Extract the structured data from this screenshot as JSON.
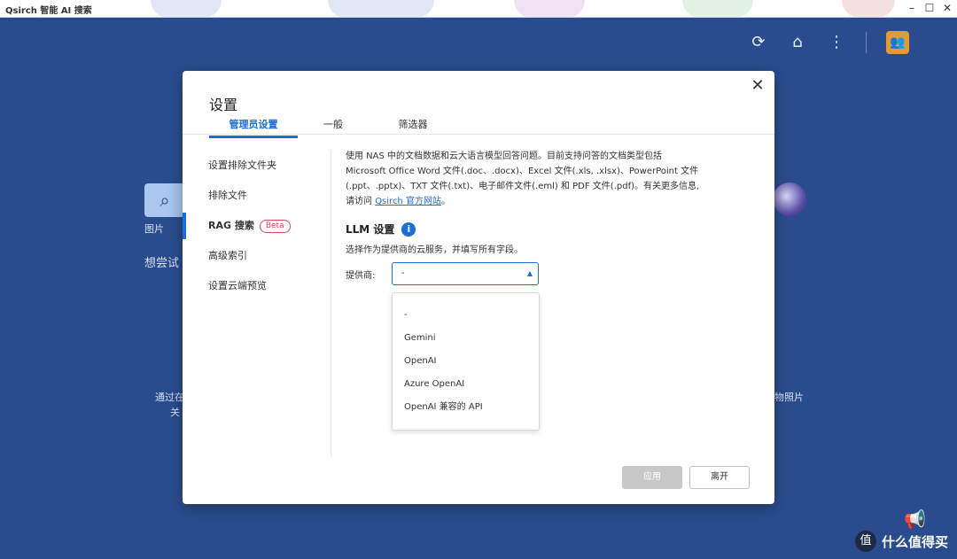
{
  "window": {
    "title": "Qsirch 智能 AI 搜索",
    "controls": [
      "–",
      "☐",
      "✕"
    ]
  },
  "background": {
    "icons": [
      "refresh-icon",
      "tray-icon",
      "more-vert-icon",
      "user-avatar-icon"
    ],
    "label_image": "图片",
    "label_try": "想尝试",
    "label_left_1": "通过在",
    "label_left_2": "关",
    "label_right": "物照片"
  },
  "dialog": {
    "title": "设置",
    "tabs": [
      {
        "label": "管理员设置",
        "active": true
      },
      {
        "label": "一般",
        "active": false
      },
      {
        "label": "筛选器",
        "active": false
      }
    ],
    "sidebar": [
      {
        "label": "设置排除文件夹",
        "active": false
      },
      {
        "label": "排除文件",
        "active": false
      },
      {
        "label": "RAG 搜索",
        "active": true,
        "badge": "Beta"
      },
      {
        "label": "高级索引",
        "active": false
      },
      {
        "label": "设置云端预览",
        "active": false
      }
    ],
    "description_lines": [
      "使用 NAS 中的文档数据和云大语言模型回答问题。目前支持问答的文档类型包括",
      "Microsoft Office Word 文件(.doc、.docx)、Excel 文件(.xls, .xlsx)、PowerPoint 文件",
      "(.ppt、.pptx)、TXT 文件(.txt)、电子邮件文件(.eml) 和 PDF 文件(.pdf)。有关更多信息,"
    ],
    "description_last_prefix": "请访问",
    "description_link": "Qsirch 官方网站",
    "description_last_suffix": "。",
    "llm_title": "LLM 设置",
    "llm_subtitle": "选择作为提供商的云服务，并填写所有字段。",
    "provider_label": "提供商:",
    "provider_selected": "-",
    "provider_options": [
      "-",
      "Gemini",
      "OpenAI",
      "Azure OpenAI",
      "OpenAI 兼容的 API"
    ],
    "apply_label": "应用",
    "leave_label": "离开"
  },
  "watermark": {
    "text": "什么值得买",
    "logo": "值"
  }
}
